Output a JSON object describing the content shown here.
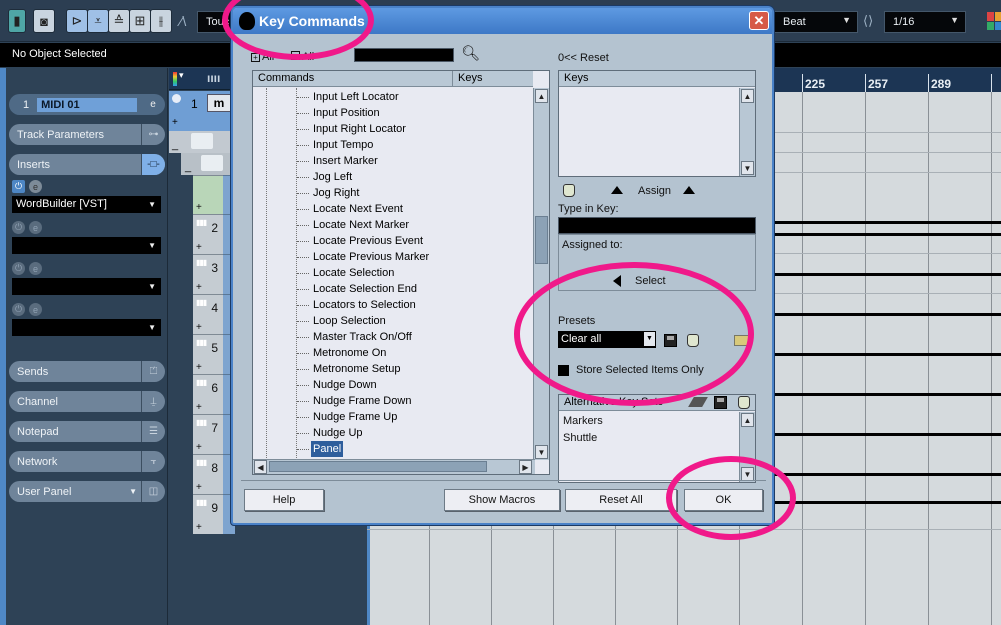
{
  "toolbar": {
    "automation_mode": "Touch",
    "quantize_type": "Beat",
    "quantize_value": "1/16"
  },
  "status_line": {
    "text": "No Object Selected"
  },
  "inspector": {
    "track": {
      "number": "1",
      "name": "MIDI 01"
    },
    "sections": {
      "track_parameters": "Track Parameters",
      "inserts": "Inserts",
      "sends": "Sends",
      "channel": "Channel",
      "notepad": "Notepad",
      "network": "Network",
      "user_panel": "User Panel"
    },
    "insert_slots": [
      "WordBuilder [VST]",
      "",
      "",
      ""
    ]
  },
  "track_list": {
    "first_track_number": "1",
    "mute_label": "m",
    "track_numbers": [
      "2",
      "3",
      "4",
      "5",
      "6",
      "7",
      "8",
      "9"
    ]
  },
  "ruler": {
    "bars": [
      "225",
      "257",
      "289"
    ]
  },
  "dialog": {
    "title": "Key Commands",
    "expand_all": "All",
    "collapse_all": "All",
    "search_value": "",
    "commands_header": "Commands",
    "keys_header": "Keys",
    "commands": [
      "Input Left Locator",
      "Input Position",
      "Input Right Locator",
      "Input Tempo",
      "Insert Marker",
      "Jog Left",
      "Jog Right",
      "Locate Next Event",
      "Locate Next Marker",
      "Locate Previous Event",
      "Locate Previous Marker",
      "Locate Selection",
      "Locate Selection End",
      "Locators to Selection",
      "Loop Selection",
      "Master Track On/Off",
      "Metronome On",
      "Metronome Setup",
      "Nudge Down",
      "Nudge Frame Down",
      "Nudge Frame Up",
      "Nudge Up",
      "Panel"
    ],
    "selected_command": "Panel",
    "reset_label": "0<< Reset",
    "keys_list_header": "Keys",
    "assign_label": "Assign",
    "type_in_key_label": "Type in Key:",
    "type_in_key_value": "",
    "assigned_to_label": "Assigned to:",
    "select_label": "Select",
    "presets_label": "Presets",
    "preset_value": "Clear all",
    "store_selected_label": "Store Selected Items Only",
    "alt_key_sets_header": "Alternative Key Sets",
    "alt_key_sets": [
      "Markers",
      "Shuttle"
    ],
    "buttons": {
      "help": "Help",
      "show_macros": "Show Macros",
      "reset_all": "Reset All",
      "ok": "OK"
    }
  },
  "colors": {
    "annotation": "#f0198a",
    "title_bar": "#3d78c6",
    "selection": "#2e5e9c"
  }
}
